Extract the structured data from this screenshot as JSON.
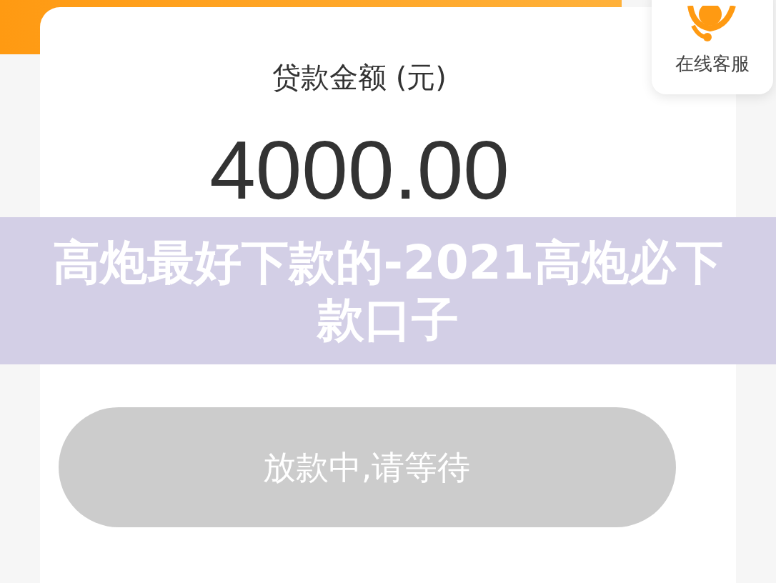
{
  "loan": {
    "label": "贷款金额 (元)",
    "amount": "4000.00"
  },
  "service": {
    "label": "在线客服"
  },
  "action_button": {
    "label": "放款中,请等待",
    "disabled": true
  },
  "caption_banner": {
    "text": "高炮最好下款的-2021高炮必下款口子"
  }
}
